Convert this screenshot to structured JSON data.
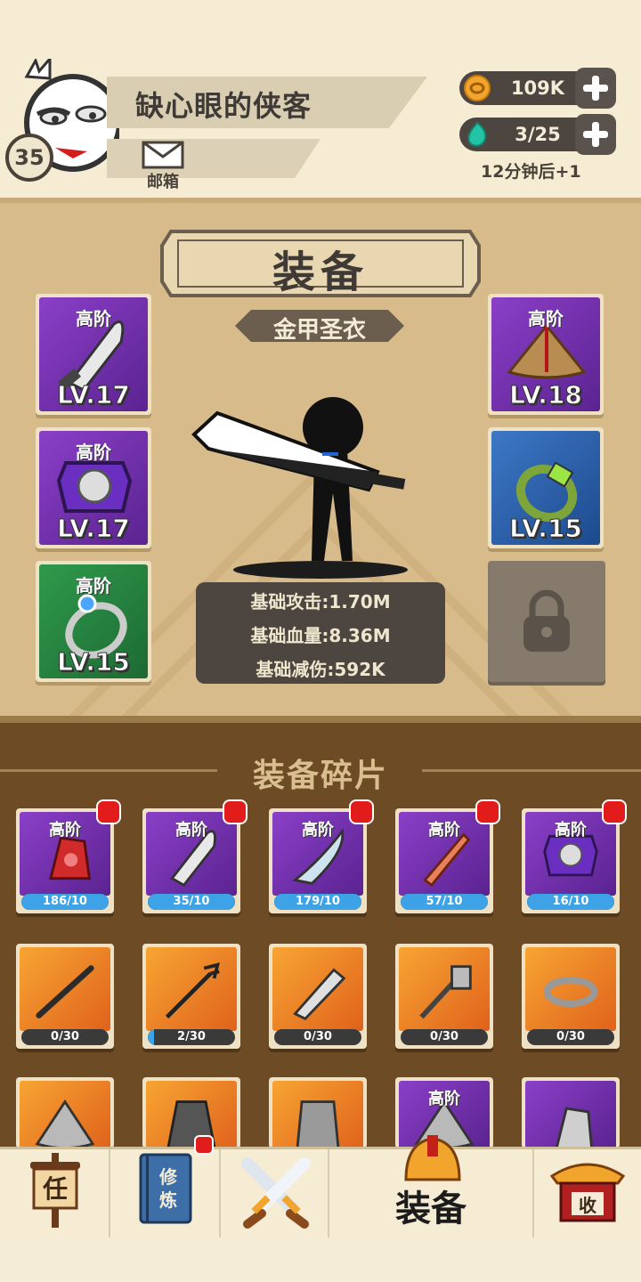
{
  "player": {
    "name": "缺心眼的侠客",
    "level": "35",
    "mail_label": "邮箱"
  },
  "resources": {
    "coins": "109K",
    "stamina": "3/25",
    "regen_text": "12分钟后+1"
  },
  "equip": {
    "title": "装备",
    "set_name": "金甲圣衣",
    "slots": [
      {
        "tier": "高阶",
        "level": "LV.17",
        "rarity": "purple",
        "icon": "broadsword-icon"
      },
      {
        "tier": "高阶",
        "level": "LV.17",
        "rarity": "purple",
        "icon": "chest-armor-icon"
      },
      {
        "tier": "高阶",
        "level": "LV.15",
        "rarity": "green",
        "icon": "gem-ring-icon"
      },
      {
        "tier": "高阶",
        "level": "LV.18",
        "rarity": "purple",
        "icon": "straw-hat-icon"
      },
      {
        "tier": "",
        "level": "LV.15",
        "rarity": "blue",
        "icon": "bracelet-icon"
      }
    ],
    "stats": {
      "attack": "基础攻击:1.70M",
      "hp": "基础血量:8.36M",
      "dmg_reduction": "基础减伤:592K"
    }
  },
  "fragments": {
    "title": "装备碎片",
    "items": [
      {
        "tier": "高阶",
        "progress": "186/10",
        "fill": 1.0,
        "rarity": "purple",
        "icon": "red-gauntlet-icon",
        "alert": true
      },
      {
        "tier": "高阶",
        "progress": "35/10",
        "fill": 1.0,
        "rarity": "purple",
        "icon": "broadsword-icon",
        "alert": true
      },
      {
        "tier": "高阶",
        "progress": "179/10",
        "fill": 1.0,
        "rarity": "purple",
        "icon": "saber-icon",
        "alert": true
      },
      {
        "tier": "高阶",
        "progress": "57/10",
        "fill": 1.0,
        "rarity": "purple",
        "icon": "flame-sword-icon",
        "alert": true
      },
      {
        "tier": "高阶",
        "progress": "16/10",
        "fill": 1.0,
        "rarity": "purple",
        "icon": "chest-armor-icon",
        "alert": true
      },
      {
        "tier": "",
        "progress": "0/30",
        "fill": 0.0,
        "rarity": "orange",
        "icon": "staff-icon",
        "alert": false
      },
      {
        "tier": "",
        "progress": "2/30",
        "fill": 0.0667,
        "rarity": "orange",
        "icon": "trident-icon",
        "alert": false
      },
      {
        "tier": "",
        "progress": "0/30",
        "fill": 0.0,
        "rarity": "orange",
        "icon": "cleaver-icon",
        "alert": false
      },
      {
        "tier": "",
        "progress": "0/30",
        "fill": 0.0,
        "rarity": "orange",
        "icon": "axe-icon",
        "alert": false
      },
      {
        "tier": "",
        "progress": "0/30",
        "fill": 0.0,
        "rarity": "orange",
        "icon": "bangle-icon",
        "alert": false
      },
      {
        "tier": "",
        "progress": "",
        "fill": 0.0,
        "rarity": "orange",
        "icon": "hat-icon",
        "alert": false
      },
      {
        "tier": "",
        "progress": "",
        "fill": 0.0,
        "rarity": "orange",
        "icon": "cloak-icon",
        "alert": false
      },
      {
        "tier": "",
        "progress": "",
        "fill": 0.0,
        "rarity": "orange",
        "icon": "vest-icon",
        "alert": false
      },
      {
        "tier": "高阶",
        "progress": "",
        "fill": 0.0,
        "rarity": "purple",
        "icon": "hat-icon",
        "alert": false
      },
      {
        "tier": "",
        "progress": "",
        "fill": 0.0,
        "rarity": "purple",
        "icon": "gauntlet-icon",
        "alert": false
      }
    ]
  },
  "nav": {
    "tasks_glyph": "任",
    "cultivate_glyph": "修炼",
    "equip_label": "装备",
    "collect_glyph": "收"
  }
}
